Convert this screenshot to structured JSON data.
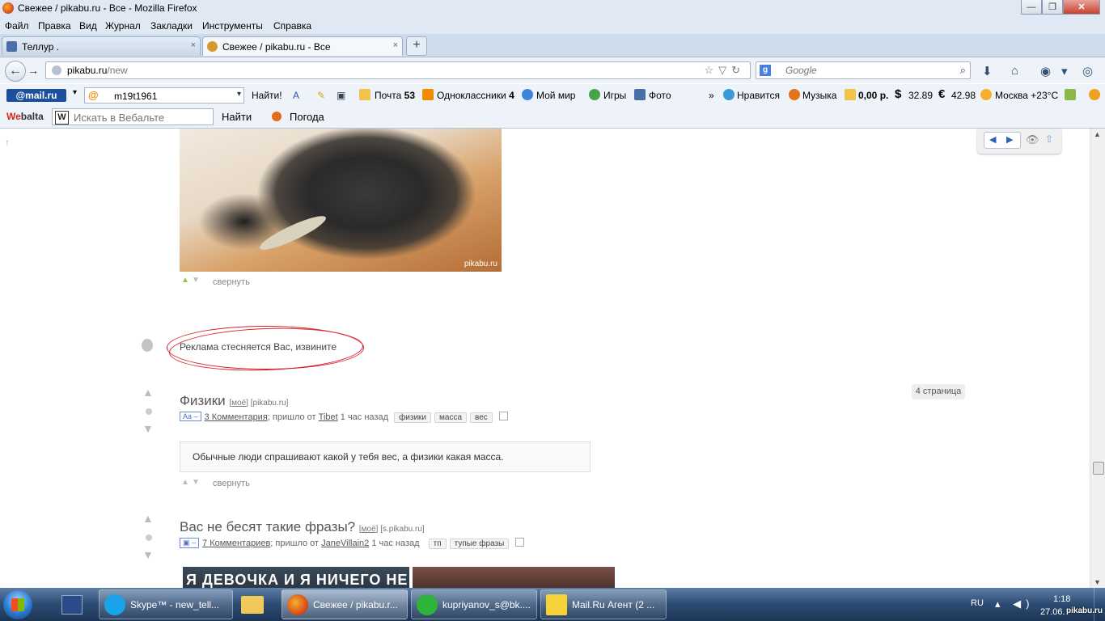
{
  "window": {
    "title": "Свежее / pikabu.ru - Все - Mozilla Firefox",
    "min": "—",
    "max": "❐",
    "close": "✕"
  },
  "menu": [
    "Файл",
    "Правка",
    "Вид",
    "Журнал",
    "Закладки",
    "Инструменты",
    "Справка"
  ],
  "tabs": [
    {
      "label": "Теллур .",
      "close": "×",
      "favicon_color": "#4a6fa8"
    },
    {
      "label": "Свежее / pikabu.ru - Все",
      "close": "×",
      "favicon_color": "#d89a2c"
    }
  ],
  "new_tab": "+",
  "nav": {
    "back": "←",
    "forward": "→",
    "url_host": "pikabu.ru",
    "url_path": "/new",
    "url_icons": "☆▽↻",
    "search_engine": "g",
    "search_placeholder": "Google",
    "search_icon": "⌕",
    "download_icon": "⬇",
    "home_icon": "⌂",
    "addon_icon": "◉",
    "menu_icon": "▾",
    "sync_icon": "◎"
  },
  "mailbar": {
    "logo": "@mail.ru",
    "user_dropdown": "▾",
    "user": "m19t1961",
    "find": "Найти!",
    "items": [
      {
        "label": "Почта",
        "count": "53"
      },
      {
        "label": "Одноклассники",
        "count": "4"
      },
      {
        "label": "Мой мир"
      },
      {
        "label": "Игры"
      },
      {
        "label": "Фото"
      },
      {
        "label": "Нравится"
      },
      {
        "label": "Музыка"
      }
    ],
    "more": "»",
    "balance": "0,00 р.",
    "usd": "32.89",
    "eur": "42.98",
    "weather": "Москва +23°C",
    "usd_sign": "$",
    "eur_sign": "€"
  },
  "webalta": {
    "logo_we": "We",
    "logo_rest": "balta",
    "w_icon": "W",
    "placeholder": "Искать в Вебальте",
    "find": "Найти",
    "weather": "Погода"
  },
  "page": {
    "image_watermark": "pikabu.ru",
    "collapse_1": "свернуть",
    "ad_text": "Реклама стесняется Вас, извините",
    "page_badge": "4 страница",
    "pager_prev": "◀",
    "pager_next": "▶",
    "eye": "👁",
    "up": "⇧",
    "scroll_top": "↑",
    "post1": {
      "title": "Физики",
      "source_mine": "моё",
      "source": "[pikabu.ru]",
      "type": "Aa –",
      "comments": "3 Комментария",
      "sent_by": "; пришло от",
      "author": "Tibet",
      "time": "1 час назад",
      "tags": [
        "физики",
        "масса",
        "вес"
      ],
      "text": "Обычные люди спрашивают какой у тебя вес, а физики какая масса.",
      "collapse": "свернуть"
    },
    "post2": {
      "title": "Вас не бесят такие фразы?",
      "source_mine": "моё",
      "source": "[s.pikabu.ru]",
      "type": "▣ –",
      "comments": "7 Комментариев",
      "sent_by": "; пришло от",
      "author": "JaneVillain2",
      "time": "1 час назад",
      "tags": [
        "тп",
        "тупые фразы"
      ],
      "image_text": "Я ДЕВОЧКА И Я НИЧЕГО НЕ ХОЧУ"
    }
  },
  "taskbar": {
    "buttons": [
      {
        "label": "Skype™ - new_tell...",
        "icon_color": "#1aa3e8"
      },
      {
        "label": "Свежее / pikabu.r...",
        "icon_color": "#e5731c"
      },
      {
        "label": "kupriyanov_s@bk....",
        "icon_color": "#2fb33a"
      },
      {
        "label": "Mail.Ru Агент (2 ...",
        "icon_color": "#f4d23a"
      }
    ],
    "lang": "RU",
    "tray": "▴ ◀)",
    "time": "1:18",
    "date": "27.06.",
    "watermark": "pikabu.ru"
  }
}
